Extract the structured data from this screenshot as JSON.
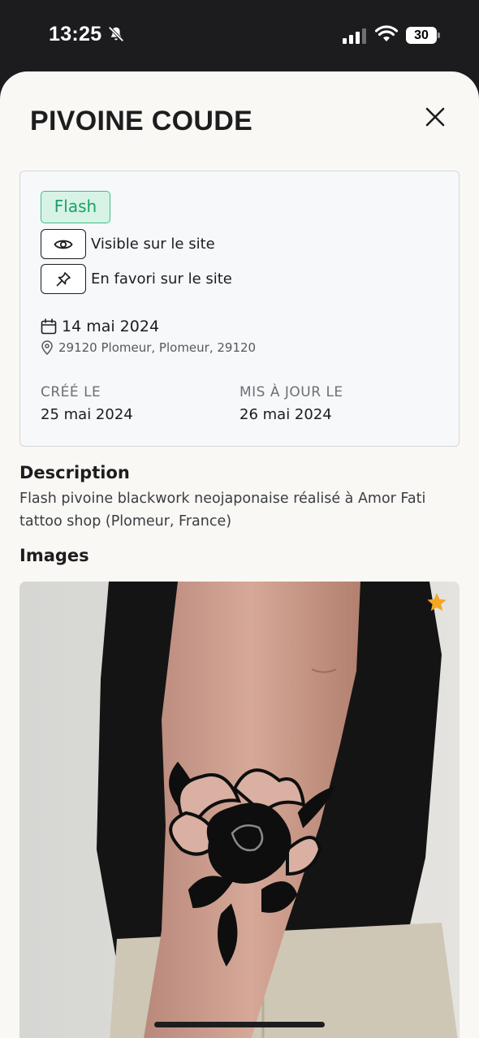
{
  "status_bar": {
    "time": "13:25",
    "battery": "30",
    "icons": [
      "bell-slash-icon",
      "signal-icon",
      "wifi-icon",
      "battery-icon"
    ]
  },
  "sheet": {
    "title": "PIVOINE COUDE",
    "close_icon": "close-icon"
  },
  "info": {
    "badge": "Flash",
    "visible_label": "Visible sur le site",
    "favorite_label": "En favori sur le site",
    "date": "14 mai 2024",
    "location": "29120 Plomeur, Plomeur, 29120",
    "created_label": "CRÉÉ LE",
    "created_value": "25 mai 2024",
    "updated_label": "MIS À JOUR LE",
    "updated_value": "26 mai 2024"
  },
  "description": {
    "heading": "Description",
    "text": "Flash pivoine blackwork neojaponaise réalisé à Amor Fati tattoo shop (Plomeur, France)"
  },
  "images": {
    "heading": "Images",
    "favorite_icon": "star-icon"
  },
  "colors": {
    "badge_bg": "#d6f3e6",
    "badge_border": "#3fbf86",
    "badge_text": "#1f9e66",
    "star": "#f5a623",
    "sheet_bg": "#faf8f5"
  }
}
